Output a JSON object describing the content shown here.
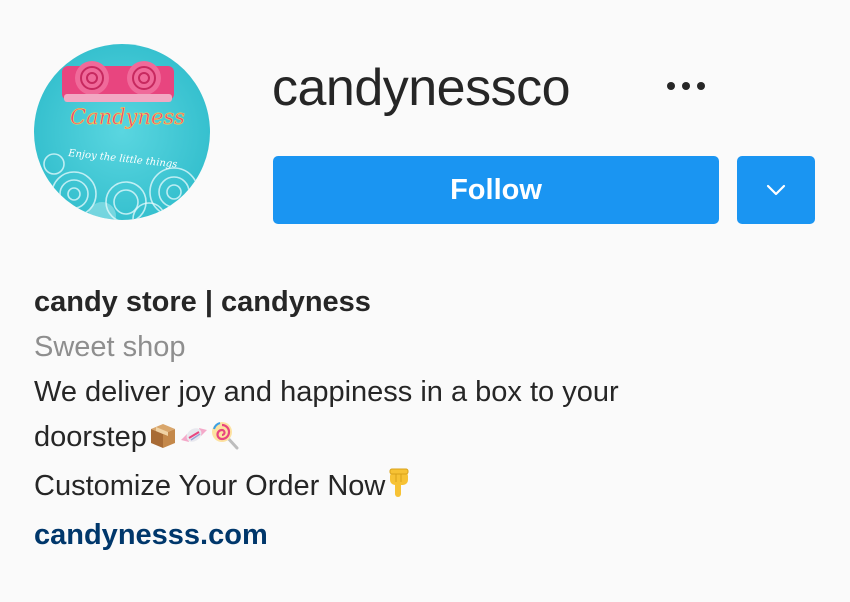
{
  "profile": {
    "username": "candynessco",
    "follow_label": "Follow",
    "avatar": {
      "logo_text": "Candyness",
      "tagline": "Enjoy the little things"
    }
  },
  "bio": {
    "name": "candy store | candyness",
    "category": "Sweet shop",
    "line1": "We deliver joy and happiness in a box to your",
    "line2": "doorstep",
    "line2_emojis": [
      "package-icon",
      "candy-icon",
      "lollipop-icon"
    ],
    "line3": "Customize Your Order Now",
    "line3_emojis": [
      "pointing-down-icon"
    ],
    "website": "candynesss.com"
  },
  "colors": {
    "button_blue": "#1a95f2",
    "link_blue": "#00376b",
    "category_gray": "#8e8e8e",
    "avatar_bg": "#40c9d6",
    "brand_pink": "#e8457f"
  }
}
